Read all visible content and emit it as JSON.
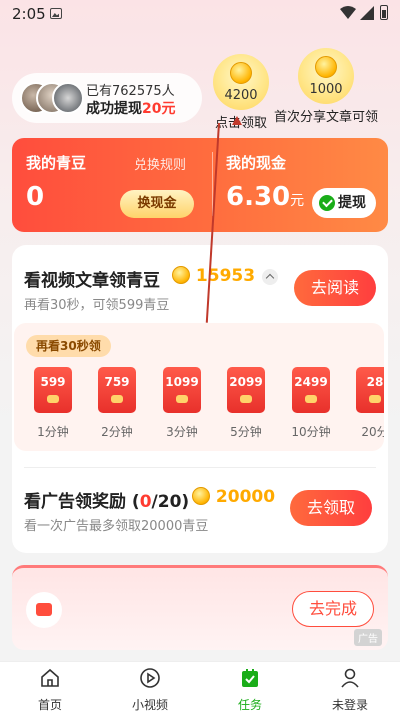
{
  "status_bar": {
    "time": "2:05"
  },
  "withdraw_pill": {
    "line1": "已有762575人",
    "line2_prefix": "成功提现",
    "line2_amount": "20元"
  },
  "coin_bubbles": [
    {
      "value": "4200",
      "label": "点击领取"
    },
    {
      "value": "1000",
      "label": "首次分享文章可领"
    }
  ],
  "cash_card": {
    "beans_title": "我的青豆",
    "rules_link": "兑换规则",
    "beans_value": "0",
    "exchange_button": "换现金",
    "cash_title": "我的现金",
    "cash_value": "6.30",
    "cash_unit": "元",
    "withdraw_button": "提现"
  },
  "video_task": {
    "title": "看视频文章领青豆",
    "coin_count": "15953",
    "subtitle": "再看30秒，可领599青豆",
    "action_button": "去阅读",
    "again_tag": "再看30秒领",
    "rewards": [
      {
        "amount": "599",
        "duration": "1分钟"
      },
      {
        "amount": "759",
        "duration": "2分钟"
      },
      {
        "amount": "1099",
        "duration": "3分钟"
      },
      {
        "amount": "2099",
        "duration": "5分钟"
      },
      {
        "amount": "2499",
        "duration": "10分钟"
      },
      {
        "amount": "28",
        "duration": "20分"
      }
    ]
  },
  "ad_task": {
    "title_prefix": "看广告领奖励 (",
    "title_done": "0",
    "title_suffix": "/20)",
    "coin_count": "20000",
    "subtitle": "看一次广告最多领取20000青豆",
    "action_button": "去领取"
  },
  "promo": {
    "action_button": "去完成",
    "ad_tag": "广告"
  },
  "bottom_nav": [
    {
      "label": "首页",
      "icon": "home-icon"
    },
    {
      "label": "小视频",
      "icon": "play-icon"
    },
    {
      "label": "任务",
      "icon": "task-icon",
      "active": true
    },
    {
      "label": "未登录",
      "icon": "user-icon"
    }
  ],
  "colors": {
    "accent_red": "#ff4d3d",
    "coin_orange": "#ffaa00",
    "active_green": "#1aad19"
  }
}
